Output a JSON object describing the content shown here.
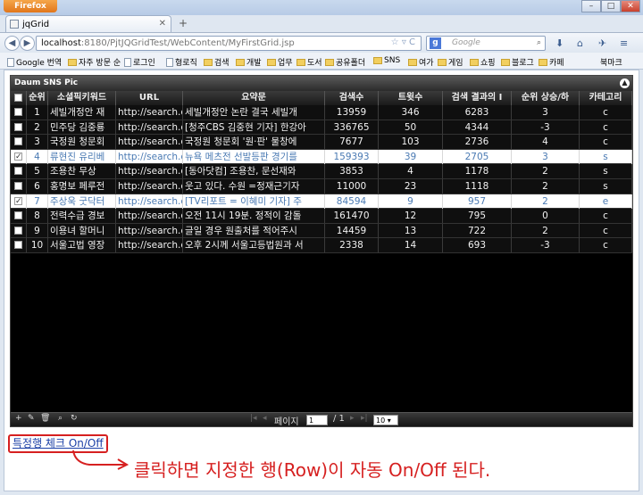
{
  "window": {
    "app_button": "Firefox",
    "controls": {
      "min": "–",
      "max": "□",
      "close": "✕"
    },
    "tab_title": "jqGrid",
    "new_tab": "+"
  },
  "nav": {
    "back": "◀",
    "forward": "▶",
    "url_host": "localhost",
    "url_rest": ":8180/PjtJQGridTest/WebContent/MyFirstGrid.jsp",
    "search_engine": "g",
    "search_placeholder": "Google"
  },
  "bookmarks": [
    {
      "label": "Google 번역",
      "icon": "page"
    },
    {
      "label": "자주 방문 순",
      "icon": "folder"
    },
    {
      "label": "로그인",
      "icon": "page"
    },
    {
      "label": "형로직",
      "icon": "page"
    },
    {
      "label": "검색",
      "icon": "folder"
    },
    {
      "label": "개발",
      "icon": "folder"
    },
    {
      "label": "업무",
      "icon": "folder"
    },
    {
      "label": "도서",
      "icon": "folder"
    },
    {
      "label": "공유폴더",
      "icon": "folder"
    },
    {
      "label": "SNS",
      "icon": "folder"
    },
    {
      "label": "여가",
      "icon": "folder"
    },
    {
      "label": "게임",
      "icon": "folder"
    },
    {
      "label": "쇼핑",
      "icon": "folder"
    },
    {
      "label": "블로그",
      "icon": "folder"
    },
    {
      "label": "카페",
      "icon": "folder"
    }
  ],
  "bookmarks_overflow": "북마크",
  "grid": {
    "caption": "Daum SNS Pic",
    "columns": [
      "",
      "순위",
      "소셜픽키워드",
      "URL",
      "요약문",
      "검색수",
      "트윗수",
      "검색 결과의 I",
      "순위 상승/하",
      "카테고리"
    ],
    "rows": [
      {
        "checked": false,
        "rank": "1",
        "keyword": "세빌개정안 재",
        "url": "http://search.d",
        "summary": "세빌개정안 논란 결국 세빌개",
        "searches": "13959",
        "tweets": "346",
        "results": "6283",
        "change": "3",
        "category": "c"
      },
      {
        "checked": false,
        "rank": "2",
        "keyword": "민주당 김중룡",
        "url": "http://search.d",
        "summary": "[청주CBS 김중현 기자] 한강아",
        "searches": "336765",
        "tweets": "50",
        "results": "4344",
        "change": "-3",
        "category": "c"
      },
      {
        "checked": false,
        "rank": "3",
        "keyword": "국정원 청문회",
        "url": "http://search.d",
        "summary": "국정원 청문회 '원·판' 물창에",
        "searches": "7677",
        "tweets": "103",
        "results": "2736",
        "change": "4",
        "category": "c"
      },
      {
        "checked": true,
        "rank": "4",
        "keyword": "류현진 유리베",
        "url": "http://search.d",
        "summary": "뉴욕 메츠전 선발등판 경기를",
        "searches": "159393",
        "tweets": "39",
        "results": "2705",
        "change": "3",
        "category": "s"
      },
      {
        "checked": false,
        "rank": "5",
        "keyword": "조용찬 무상",
        "url": "http://search.d",
        "summary": "[동아닷컴] 조용찬, 문선재와",
        "searches": "3853",
        "tweets": "4",
        "results": "1178",
        "change": "2",
        "category": "s"
      },
      {
        "checked": false,
        "rank": "6",
        "keyword": "홍명보 페루전",
        "url": "http://search.d",
        "summary": "웃고 있다. 수원 =정재근기자",
        "searches": "11000",
        "tweets": "23",
        "results": "1118",
        "change": "2",
        "category": "s"
      },
      {
        "checked": true,
        "rank": "7",
        "keyword": "주상욱 굿닥터",
        "url": "http://search.d",
        "summary": "[TV리포트 = 이혜미 기자] 주",
        "searches": "84594",
        "tweets": "9",
        "results": "957",
        "change": "2",
        "category": "e"
      },
      {
        "checked": false,
        "rank": "8",
        "keyword": "전력수급 경보",
        "url": "http://search.d",
        "summary": "오전 11시 19분. 정적이 감돌",
        "searches": "161470",
        "tweets": "12",
        "results": "795",
        "change": "0",
        "category": "c"
      },
      {
        "checked": false,
        "rank": "9",
        "keyword": "이용녀 할머니",
        "url": "http://search.d",
        "summary": "글일 경우 원출처를 적어주시",
        "searches": "14459",
        "tweets": "13",
        "results": "722",
        "change": "2",
        "category": "c"
      },
      {
        "checked": false,
        "rank": "10",
        "keyword": "서울고법 영장",
        "url": "http://search.d",
        "summary": "오후 2시께 서울고등법원과 서",
        "searches": "2338",
        "tweets": "14",
        "results": "693",
        "change": "-3",
        "category": "c"
      }
    ],
    "pager": {
      "add": "+",
      "edit": "✎",
      "delete": "🗑",
      "search": "⌕",
      "refresh": "↻",
      "page_label": "페이지",
      "page_value": "1",
      "of_label": "/ 1",
      "rows_per_page": "10 ▾"
    }
  },
  "toggle_link": "특정행 체크 On/Off",
  "annotation": "클릭하면 지정한 행(Row)이 자동 On/Off 된다.",
  "colors": {
    "accent_red": "#d62020",
    "selected_text": "#4a7ab3",
    "link": "#1a3fa6"
  }
}
